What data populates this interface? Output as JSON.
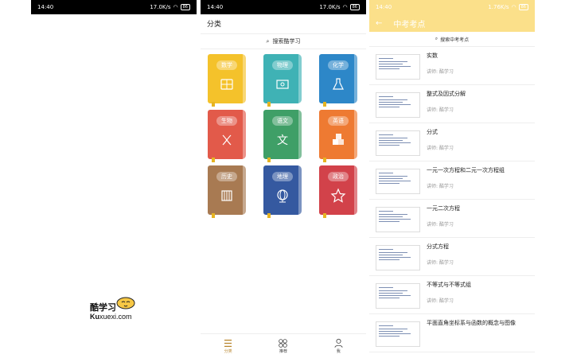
{
  "screens": {
    "splash": {
      "status": {
        "time": "14:40",
        "speed": "17.0K/s",
        "battery": "86"
      },
      "logo": {
        "cn": "酷学习",
        "en_bold": "Ku",
        "en_rest": "xuexi.com"
      }
    },
    "category": {
      "status": {
        "time": "14:40",
        "speed": "17.0K/s",
        "battery": "86"
      },
      "title": "分类",
      "search": "搜索酷学习",
      "subjects": [
        {
          "label": "数学",
          "color": "#f4c22b",
          "icon": "calculator-icon"
        },
        {
          "label": "物理",
          "color": "#3fb2b5",
          "icon": "circuit-icon"
        },
        {
          "label": "化学",
          "color": "#2d87c8",
          "icon": "flask-icon"
        },
        {
          "label": "生物",
          "color": "#e25a4a",
          "icon": "dna-icon"
        },
        {
          "label": "语文",
          "color": "#3f9f67",
          "icon": "wen-character-icon"
        },
        {
          "label": "英语",
          "color": "#ee7a32",
          "icon": "abc-blocks-icon"
        },
        {
          "label": "历史",
          "color": "#a87a52",
          "icon": "scroll-icon"
        },
        {
          "label": "地理",
          "color": "#3559a0",
          "icon": "globe-icon"
        },
        {
          "label": "政治",
          "color": "#d2424a",
          "icon": "star-badge-icon"
        }
      ],
      "tabs": [
        {
          "label": "分类",
          "icon": "list-icon",
          "active": true
        },
        {
          "label": "推荐",
          "icon": "grid-circles-icon",
          "active": false
        },
        {
          "label": "我",
          "icon": "user-icon",
          "active": false
        }
      ]
    },
    "list": {
      "status": {
        "time": "14:40",
        "speed": "1.76K/s",
        "battery": "86"
      },
      "title": "中考考点",
      "search": "搜索中考考点",
      "items": [
        {
          "title": "实数",
          "author": "讲师: 酷学习"
        },
        {
          "title": "整式及因式分解",
          "author": "讲师: 酷学习"
        },
        {
          "title": "分式",
          "author": "讲师: 酷学习"
        },
        {
          "title": "一元一次方程和二元一次方程组",
          "author": "讲师: 酷学习"
        },
        {
          "title": "一元二次方程",
          "author": "讲师: 酷学习"
        },
        {
          "title": "分式方程",
          "author": "讲师: 酷学习"
        },
        {
          "title": "不等式与不等式组",
          "author": "讲师: 酷学习"
        },
        {
          "title": "平面直角坐标系与函数的概念与图像",
          "author": ""
        }
      ]
    }
  },
  "colors": {
    "accent": "#fbe08a",
    "tab_active": "#b8862e"
  }
}
